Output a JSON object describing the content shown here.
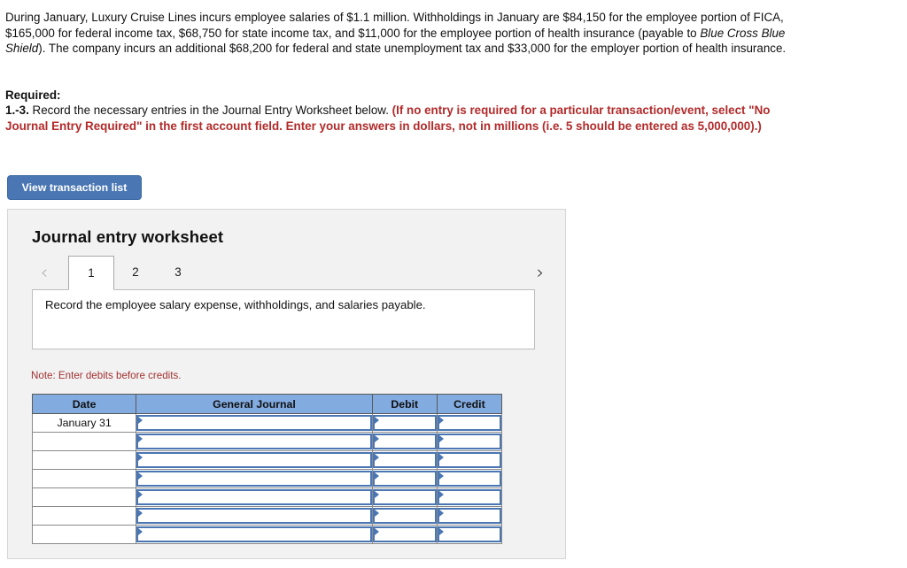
{
  "problem": {
    "segments": [
      {
        "text": "During January, Luxury Cruise Lines incurs employee salaries of $1.1 million. Withholdings in January are $84,150 for the employee portion of FICA, $165,000 for federal income tax, $68,750 for state income tax, and $11,000 for the employee portion of health insurance (payable to ",
        "style": "normal"
      },
      {
        "text": "Blue Cross Blue Shield",
        "style": "italic"
      },
      {
        "text": "). The company incurs an additional $68,200 for federal and state unemployment tax and $33,000 for the employer portion of health insurance.",
        "style": "normal"
      }
    ]
  },
  "required": {
    "label": "Required:",
    "number": "1.-3.",
    "instruction": " Record the necessary entries in the Journal Entry Worksheet below. ",
    "emphasis": "(If no entry is required for a particular transaction/event, select \"No Journal Entry Required\" in the first account field. Enter your answers in dollars, not in millions (i.e. 5 should be entered as 5,000,000).)"
  },
  "toolbar": {
    "view_transaction_list_label": "View transaction list"
  },
  "worksheet": {
    "title": "Journal entry worksheet",
    "prev_icon": "‹",
    "next_icon": "›",
    "tabs": [
      {
        "label": "1",
        "active": true
      },
      {
        "label": "2",
        "active": false
      },
      {
        "label": "3",
        "active": false
      }
    ],
    "description": "Record the employee salary expense, withholdings, and salaries payable.",
    "note": "Note: Enter debits before credits.",
    "table": {
      "columns": [
        "Date",
        "General Journal",
        "Debit",
        "Credit"
      ],
      "rows": [
        {
          "date": "January 31",
          "general_journal": "",
          "debit": "",
          "credit": ""
        },
        {
          "date": "",
          "general_journal": "",
          "debit": "",
          "credit": ""
        },
        {
          "date": "",
          "general_journal": "",
          "debit": "",
          "credit": ""
        },
        {
          "date": "",
          "general_journal": "",
          "debit": "",
          "credit": ""
        },
        {
          "date": "",
          "general_journal": "",
          "debit": "",
          "credit": ""
        },
        {
          "date": "",
          "general_journal": "",
          "debit": "",
          "credit": ""
        },
        {
          "date": "",
          "general_journal": "",
          "debit": "",
          "credit": ""
        }
      ]
    }
  },
  "colors": {
    "button_blue": "#4a77b4",
    "header_blue": "#82abe0",
    "alert_red": "#b32a2a",
    "note_red": "#a33030",
    "panel_bg": "#f2f2f2"
  }
}
